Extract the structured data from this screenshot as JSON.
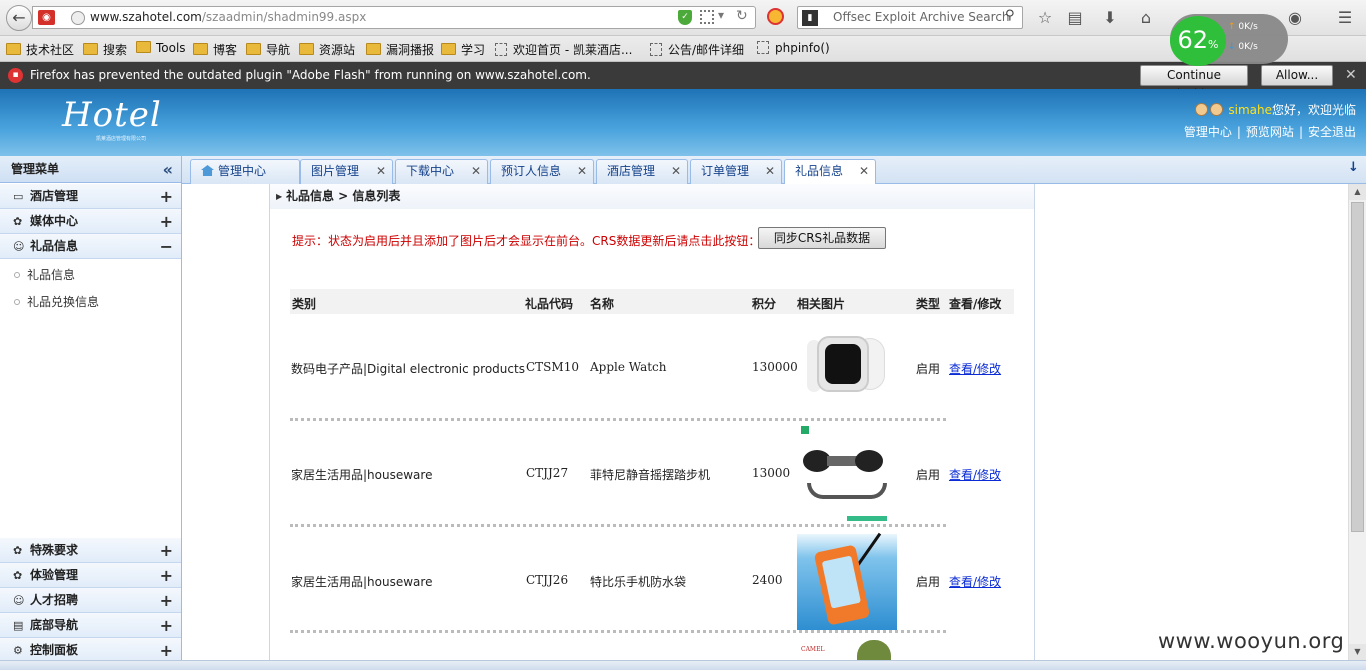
{
  "browser": {
    "url_domain": "www.szahotel.com",
    "url_path": "/szaadmin/shadmin99.aspx",
    "search_placeholder": "Offsec Exploit Archive Search",
    "bookmarks": [
      "技术社区",
      "搜索",
      "Tools",
      "博客",
      "导航",
      "资源站",
      "漏洞播报",
      "学习",
      "欢迎首页 - 凯莱酒店...",
      "公告/邮件详细",
      "phpinfo()"
    ],
    "speed": {
      "percent": "62",
      "percent_unit": "%",
      "up": "0K/s",
      "down": "0K/s"
    },
    "plugin_notice": "Firefox has prevented the outdated plugin \"Adobe Flash\" from running on www.szahotel.com.",
    "continue_blocking": "Continue Blocking",
    "allow": "Allow..."
  },
  "header": {
    "logo_text": "Hotel",
    "logo_sub": "凯莱酒店管理有限公司",
    "username": "simahe",
    "welcome": "您好，欢迎光临",
    "links": [
      "管理中心",
      "预览网站",
      "安全退出"
    ]
  },
  "leftmenu": {
    "title": "管理菜单",
    "sections": [
      {
        "label": "酒店管理",
        "icon": "monitor-icon",
        "expanded": false
      },
      {
        "label": "媒体中心",
        "icon": "leaf-icon",
        "expanded": false
      },
      {
        "label": "礼品信息",
        "icon": "users-icon",
        "expanded": true
      }
    ],
    "sub_items": [
      "礼品信息",
      "礼品兑换信息"
    ],
    "bottom_sections": [
      {
        "label": "特殊要求",
        "icon": "leaf-icon"
      },
      {
        "label": "体验管理",
        "icon": "leaf-icon"
      },
      {
        "label": "人才招聘",
        "icon": "users-icon"
      },
      {
        "label": "底部导航",
        "icon": "book-icon"
      },
      {
        "label": "控制面板",
        "icon": "gear-icon"
      }
    ]
  },
  "tabs": [
    {
      "label": "管理中心",
      "closable": false,
      "active": false
    },
    {
      "label": "图片管理",
      "closable": true,
      "active": false
    },
    {
      "label": "下载中心",
      "closable": true,
      "active": false
    },
    {
      "label": "预订人信息",
      "closable": true,
      "active": false
    },
    {
      "label": "酒店管理",
      "closable": true,
      "active": false
    },
    {
      "label": "订单管理",
      "closable": true,
      "active": false
    },
    {
      "label": "礼品信息",
      "closable": true,
      "active": true
    }
  ],
  "panel": {
    "breadcrumb": "礼品信息 > 信息列表",
    "hint": "提示：状态为启用后并且添加了图片后才会显示在前台。CRS数据更新后请点击此按钮：",
    "sync_button": "同步CRS礼品数据",
    "columns": [
      "类别",
      "礼品代码",
      "名称",
      "积分",
      "相关图片",
      "类型",
      "查看/修改"
    ],
    "rows": [
      {
        "category": "数码电子产品|Digital electronic products",
        "code": "CTSM10",
        "name": "Apple Watch",
        "points": "130000",
        "image": "apple-watch-image",
        "status": "启用",
        "action": "查看/修改"
      },
      {
        "category": "家居生活用品|houseware",
        "code": "CTJJ27",
        "name": "菲特尼静音摇摆踏步机",
        "points": "13000",
        "image": "stepper-machine-image",
        "status": "启用",
        "action": "查看/修改"
      },
      {
        "category": "家居生活用品|houseware",
        "code": "CTJJ26",
        "name": "特比乐手机防水袋",
        "points": "2400",
        "image": "waterproof-phone-bag-image",
        "status": "启用",
        "action": "查看/修改"
      }
    ],
    "next_row_image_text": "CAMEL"
  },
  "watermark": "www.wooyun.org",
  "colors": {
    "header_blue": "#2b86c9",
    "hint_red": "#cc0000",
    "link_blue": "#0a2bd6",
    "username_yellow": "#ffe21a"
  }
}
